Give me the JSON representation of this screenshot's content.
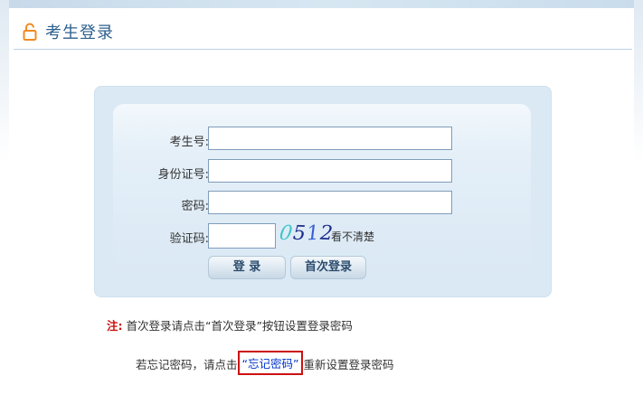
{
  "header": {
    "title": "考生登录",
    "icon": "lock-icon",
    "accent": "#f08a24"
  },
  "form": {
    "fields": [
      {
        "label": "考生号:",
        "value": "",
        "placeholder": ""
      },
      {
        "label": "身份证号:",
        "value": "",
        "placeholder": ""
      },
      {
        "label": "密码:",
        "value": "",
        "placeholder": ""
      }
    ],
    "captcha": {
      "label": "验证码:",
      "value": "",
      "digits": [
        {
          "char": "0",
          "color": "#3fc6c9"
        },
        {
          "char": "5",
          "color": "#1a2c8a"
        },
        {
          "char": "1",
          "color": "#3a5fd0"
        },
        {
          "char": "2",
          "color": "#1a2c8a"
        }
      ],
      "refresh_text": "看不清楚"
    },
    "buttons": {
      "login": "登 录",
      "first_login": "首次登录"
    }
  },
  "notes": {
    "prefix": "注:",
    "line1": "首次登录请点击“首次登录”按钮设置登录密码",
    "line2_before": "若忘记密码，请点击",
    "forgot_link": "“忘记密码”",
    "line2_after": "重新设置登录密码"
  }
}
